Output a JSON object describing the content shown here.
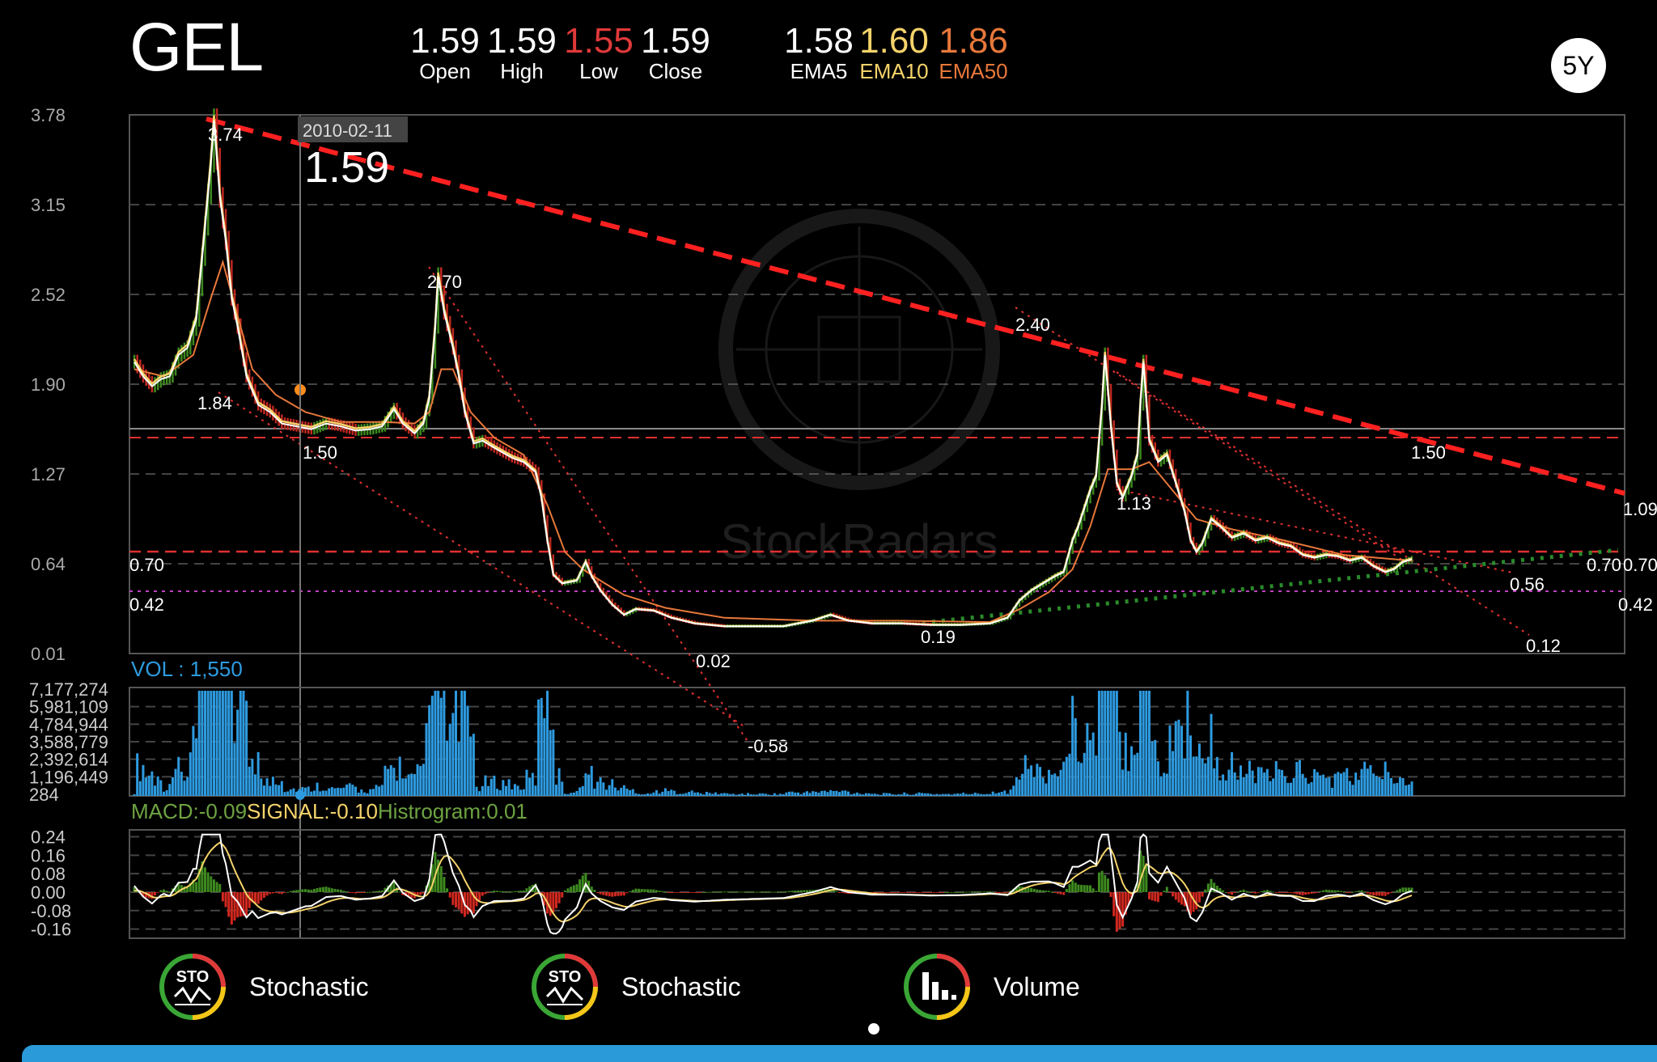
{
  "header": {
    "ticker": "GEL",
    "open": {
      "value": "1.59",
      "label": "Open"
    },
    "high": {
      "value": "1.59",
      "label": "High"
    },
    "low": {
      "value": "1.55",
      "label": "Low"
    },
    "close": {
      "value": "1.59",
      "label": "Close"
    },
    "ema5": {
      "value": "1.58",
      "label": "EMA5"
    },
    "ema10": {
      "value": "1.60",
      "label": "EMA10"
    },
    "ema50": {
      "value": "1.86",
      "label": "EMA50"
    },
    "period": "5Y"
  },
  "crosshair": {
    "date": "2010-02-11",
    "price": "1.59"
  },
  "watermark": "StockRadars",
  "colors": {
    "background": "#000000",
    "low": "#e0393a",
    "ema10": "#f5d36a",
    "ema50": "#e8783a",
    "volume": "#2e9be0",
    "macd_label": "#6da342",
    "trendline": "#ff2020",
    "support": "#2a8a2a",
    "magenta": "#c040c0",
    "bottom_bar": "#2a9ad8"
  },
  "chart_data": [
    {
      "type": "candlestick",
      "name": "price",
      "ylim": [
        0.01,
        3.78
      ],
      "yticks": [
        "3.78",
        "3.15",
        "2.52",
        "1.90",
        "1.27",
        "0.64",
        "0.01"
      ],
      "grid": true,
      "series": [
        {
          "name": "Close",
          "points": [
            [
              0,
              2.05
            ],
            [
              3,
              1.95
            ],
            [
              6,
              1.88
            ],
            [
              9,
              1.93
            ],
            [
              12,
              1.95
            ],
            [
              15,
              2.1
            ],
            [
              18,
              2.15
            ],
            [
              21,
              2.35
            ],
            [
              24,
              3.0
            ],
            [
              26,
              3.45
            ],
            [
              27,
              3.74
            ],
            [
              29,
              3.2
            ],
            [
              31,
              2.9
            ],
            [
              33,
              2.5
            ],
            [
              35,
              2.3
            ],
            [
              38,
              1.95
            ],
            [
              42,
              1.75
            ],
            [
              46,
              1.7
            ],
            [
              50,
              1.62
            ],
            [
              55,
              1.6
            ],
            [
              60,
              1.58
            ],
            [
              65,
              1.62
            ],
            [
              70,
              1.6
            ],
            [
              75,
              1.57
            ],
            [
              80,
              1.58
            ],
            [
              84,
              1.6
            ],
            [
              88,
              1.72
            ],
            [
              91,
              1.62
            ],
            [
              95,
              1.55
            ],
            [
              98,
              1.62
            ],
            [
              100,
              1.8
            ],
            [
              102,
              2.3
            ],
            [
              103,
              2.65
            ],
            [
              105,
              2.4
            ],
            [
              108,
              2.15
            ],
            [
              110,
              1.95
            ],
            [
              112,
              1.7
            ],
            [
              115,
              1.48
            ],
            [
              118,
              1.5
            ],
            [
              122,
              1.45
            ],
            [
              128,
              1.38
            ],
            [
              132,
              1.35
            ],
            [
              136,
              1.28
            ],
            [
              138,
              1.1
            ],
            [
              140,
              0.8
            ],
            [
              142,
              0.56
            ],
            [
              145,
              0.5
            ],
            [
              150,
              0.52
            ],
            [
              153,
              0.65
            ],
            [
              155,
              0.55
            ],
            [
              158,
              0.45
            ],
            [
              162,
              0.35
            ],
            [
              166,
              0.28
            ],
            [
              170,
              0.32
            ],
            [
              176,
              0.31
            ],
            [
              182,
              0.26
            ],
            [
              190,
              0.22
            ],
            [
              200,
              0.2
            ],
            [
              210,
              0.2
            ],
            [
              220,
              0.2
            ],
            [
              230,
              0.24
            ],
            [
              236,
              0.28
            ],
            [
              242,
              0.24
            ],
            [
              250,
              0.22
            ],
            [
              260,
              0.22
            ],
            [
              270,
              0.21
            ],
            [
              280,
              0.21
            ],
            [
              290,
              0.22
            ],
            [
              296,
              0.26
            ],
            [
              300,
              0.38
            ],
            [
              304,
              0.45
            ],
            [
              308,
              0.5
            ],
            [
              312,
              0.55
            ],
            [
              315,
              0.58
            ],
            [
              318,
              0.8
            ],
            [
              320,
              0.9
            ],
            [
              324,
              1.15
            ],
            [
              326,
              1.25
            ],
            [
              328,
              1.75
            ],
            [
              329,
              2.1
            ],
            [
              331,
              1.6
            ],
            [
              333,
              1.2
            ],
            [
              335,
              1.1
            ],
            [
              338,
              1.25
            ],
            [
              340,
              1.4
            ],
            [
              341,
              1.75
            ],
            [
              342,
              2.05
            ],
            [
              344,
              1.5
            ],
            [
              347,
              1.35
            ],
            [
              350,
              1.4
            ],
            [
              353,
              1.2
            ],
            [
              356,
              1.0
            ],
            [
              358,
              0.8
            ],
            [
              360,
              0.72
            ],
            [
              362,
              0.78
            ],
            [
              365,
              0.95
            ],
            [
              368,
              0.9
            ],
            [
              372,
              0.82
            ],
            [
              376,
              0.85
            ],
            [
              380,
              0.8
            ],
            [
              384,
              0.82
            ],
            [
              388,
              0.78
            ],
            [
              392,
              0.76
            ],
            [
              396,
              0.7
            ],
            [
              400,
              0.68
            ],
            [
              404,
              0.7
            ],
            [
              408,
              0.69
            ],
            [
              412,
              0.66
            ],
            [
              416,
              0.68
            ],
            [
              420,
              0.62
            ],
            [
              424,
              0.58
            ],
            [
              427,
              0.6
            ],
            [
              430,
              0.65
            ],
            [
              433,
              0.67
            ]
          ]
        },
        {
          "name": "EMA50",
          "points": [
            [
              0,
              2.0
            ],
            [
              10,
              1.95
            ],
            [
              20,
              2.1
            ],
            [
              26,
              2.5
            ],
            [
              30,
              2.75
            ],
            [
              34,
              2.45
            ],
            [
              40,
              2.0
            ],
            [
              48,
              1.82
            ],
            [
              58,
              1.7
            ],
            [
              70,
              1.63
            ],
            [
              85,
              1.63
            ],
            [
              95,
              1.62
            ],
            [
              100,
              1.7
            ],
            [
              104,
              2.0
            ],
            [
              108,
              2.0
            ],
            [
              114,
              1.7
            ],
            [
              122,
              1.52
            ],
            [
              132,
              1.4
            ],
            [
              140,
              1.05
            ],
            [
              146,
              0.72
            ],
            [
              152,
              0.6
            ],
            [
              158,
              0.52
            ],
            [
              166,
              0.42
            ],
            [
              180,
              0.33
            ],
            [
              200,
              0.26
            ],
            [
              230,
              0.24
            ],
            [
              260,
              0.24
            ],
            [
              290,
              0.23
            ],
            [
              300,
              0.32
            ],
            [
              310,
              0.44
            ],
            [
              318,
              0.6
            ],
            [
              324,
              0.9
            ],
            [
              330,
              1.3
            ],
            [
              338,
              1.3
            ],
            [
              344,
              1.35
            ],
            [
              352,
              1.15
            ],
            [
              360,
              0.95
            ],
            [
              372,
              0.88
            ],
            [
              390,
              0.8
            ],
            [
              410,
              0.7
            ],
            [
              433,
              0.66
            ]
          ]
        }
      ],
      "levels": [
        {
          "value": 1.5,
          "label": "1.50",
          "style": "dashed-red"
        },
        {
          "value": 0.7,
          "label": "0.70",
          "style": "dashed-red"
        },
        {
          "value": 0.42,
          "label": "0.42",
          "style": "dotted-magenta"
        }
      ],
      "annotations": [
        "3.74",
        "2.70",
        "2.40",
        "1.84",
        "1.50",
        "1.13",
        "0.02",
        "-0.58",
        "0.19",
        "0.56",
        "0.12",
        "1.50",
        "1.09",
        "0.70",
        "0.70",
        "0.70",
        "0.42",
        "0.42"
      ]
    },
    {
      "type": "bar",
      "name": "volume",
      "title": "VOL : 1,550",
      "yticks": [
        "7,177,274",
        "5,981,109",
        "4,784,944",
        "3,588,779",
        "2,392,614",
        "1,196,449",
        "284"
      ],
      "ylim": [
        284,
        7177274
      ]
    },
    {
      "type": "bar",
      "name": "macd",
      "title_parts": {
        "macd": "MACD:-0.09",
        "signal": "SIGNAL:-0.10",
        "histogram": "Histrogram:0.01"
      },
      "yticks": [
        "0.24",
        "0.16",
        "0.08",
        "0.00",
        "-0.08",
        "-0.16"
      ],
      "ylim": [
        -0.2,
        0.27
      ]
    }
  ],
  "indicators": [
    {
      "badge": "STO",
      "label": "Stochastic"
    },
    {
      "badge": "STO",
      "label": "Stochastic"
    },
    {
      "badge": "VOL",
      "label": "Volume"
    }
  ]
}
